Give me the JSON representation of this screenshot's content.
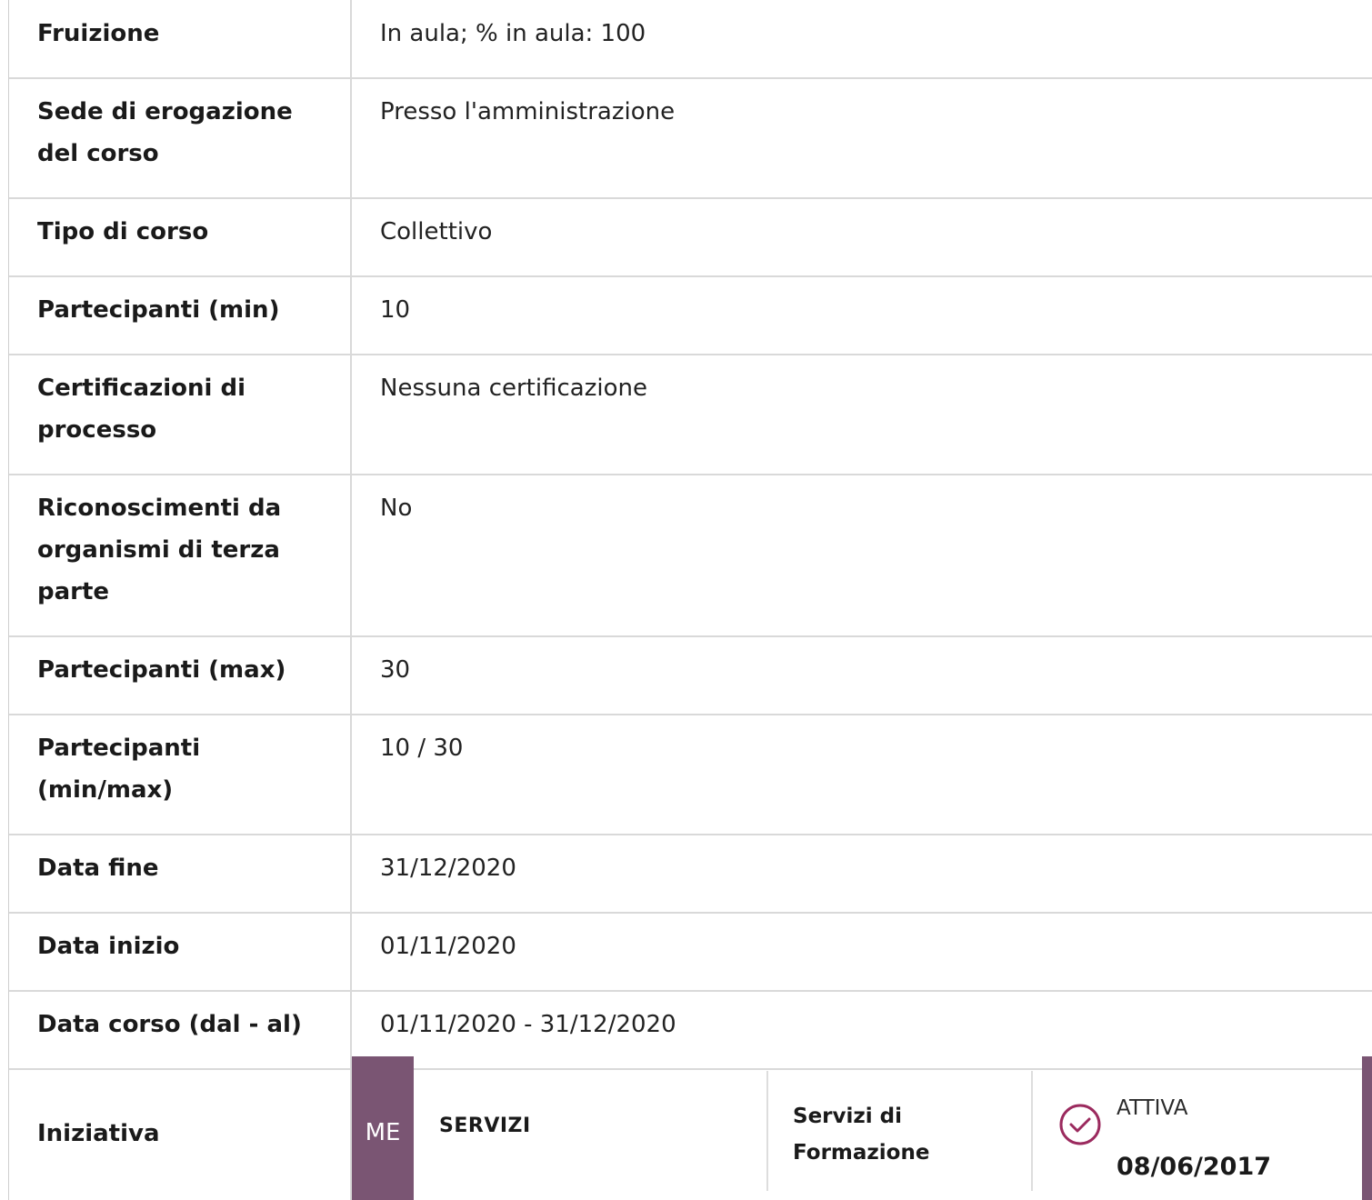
{
  "rows": [
    {
      "label": "Fruizione",
      "value": "In aula; % in aula: 100"
    },
    {
      "label": "Sede di erogazione del corso",
      "value": "Presso l'amministrazione"
    },
    {
      "label": "Tipo di corso",
      "value": "Collettivo"
    },
    {
      "label": "Partecipanti (min)",
      "value": "10"
    },
    {
      "label": "Certificazioni di processo",
      "value": "Nessuna certificazione"
    },
    {
      "label": "Riconoscimenti da organismi di terza parte",
      "value": "No"
    },
    {
      "label": "Partecipanti (max)",
      "value": "30"
    },
    {
      "label": "Partecipanti (min/max)",
      "value": "10 / 30"
    },
    {
      "label": "Data fine",
      "value": "31/12/2020"
    },
    {
      "label": "Data inizio",
      "value": "01/11/2020"
    },
    {
      "label": "Data corso (dal - al)",
      "value": "01/11/2020 - 31/12/2020"
    }
  ],
  "iniziativa": {
    "label": "Iniziativa",
    "badge": "ME",
    "category": "SERVIZI",
    "area": "Servizi di Formazione",
    "status": "ATTIVA",
    "date": "08/06/2017",
    "status_icon": "check-circle-icon",
    "accent_color": "#7a5573"
  }
}
